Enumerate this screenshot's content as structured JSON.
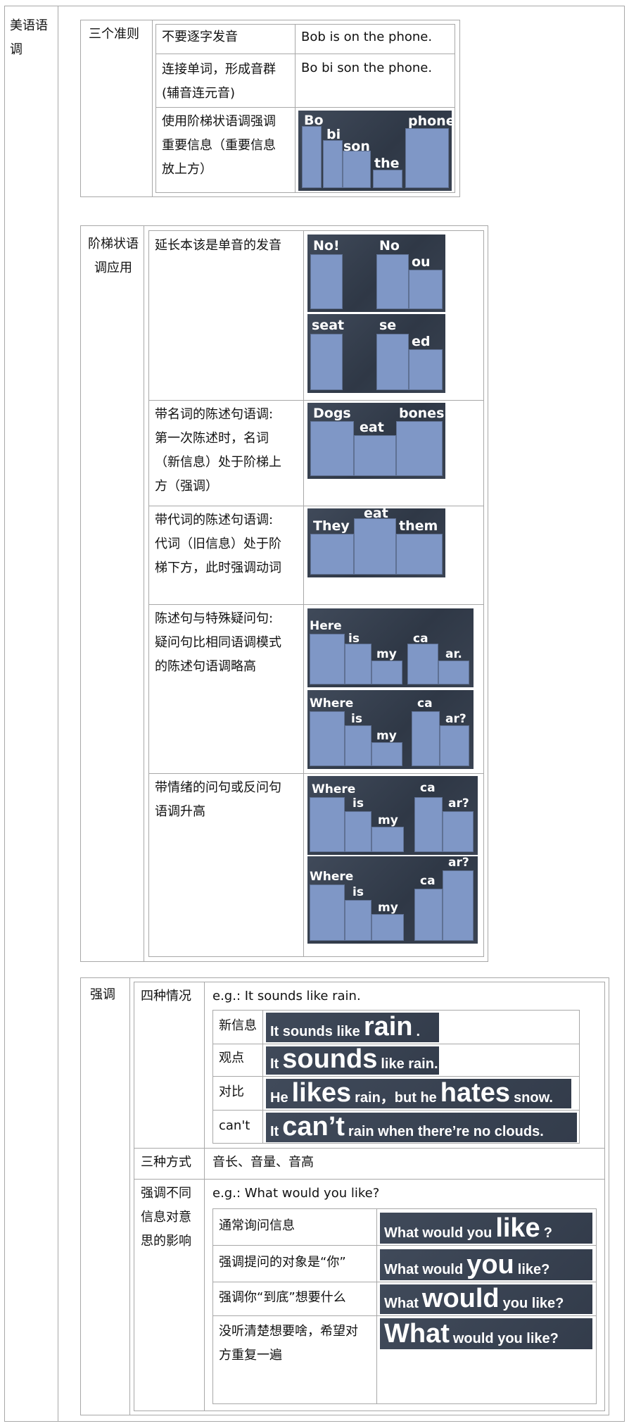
{
  "outer_label": "美语语调",
  "rules": {
    "label": "三个准则",
    "rows": [
      {
        "desc": "不要逐字发音",
        "example": "Bob is on the phone."
      },
      {
        "desc": "连接单词，形成音群\n(辅音连元音)",
        "example": "Bo bi son the phone."
      },
      {
        "desc": "使用阶梯状语调强调\n重要信息（重要信息\n放上方）",
        "words": [
          "Bo",
          "bi",
          "son",
          "the",
          "phone"
        ]
      }
    ]
  },
  "staircase": {
    "label": "阶梯状语\n调应用",
    "rows": [
      {
        "desc": "延长本该是单音的发音",
        "img1": [
          "No!",
          "No",
          "ou"
        ],
        "img2": [
          "seat",
          "se",
          "ed"
        ]
      },
      {
        "desc": "带名词的陈述句语调:\n第一次陈述时，名词\n（新信息）处于阶梯上\n方（强调）",
        "img1": [
          "Dogs",
          "eat",
          "bones"
        ]
      },
      {
        "desc": "带代词的陈述句语调:\n代词（旧信息）处于阶\n梯下方，此时强调动词",
        "img1": [
          "They",
          "eat",
          "them"
        ]
      },
      {
        "desc": "陈述句与特殊疑问句:\n疑问句比相同语调模式\n的陈述句语调略高",
        "img1": [
          "Here",
          "is",
          "my",
          "ca",
          "ar."
        ],
        "img2": [
          "Where",
          "is",
          "my",
          "ca",
          "ar?"
        ]
      },
      {
        "desc": "带情绪的问句或反问句\n语调升高",
        "img1": [
          "Where",
          "is",
          "my",
          "ca",
          "ar?"
        ],
        "img2": [
          "Where",
          "is",
          "my",
          "ca",
          "ar?"
        ]
      }
    ]
  },
  "stress": {
    "label": "强调",
    "four": {
      "label": "四种情况",
      "example": "e.g.: It sounds like rain.",
      "rows": [
        {
          "label": "新信息",
          "parts": [
            [
              "It sounds like",
              "s"
            ],
            [
              "rain",
              "b"
            ],
            [
              ".",
              "s"
            ]
          ]
        },
        {
          "label": "观点",
          "parts": [
            [
              "It",
              "s"
            ],
            [
              "sounds",
              "b"
            ],
            [
              "like rain.",
              "s"
            ]
          ]
        },
        {
          "label": "对比",
          "parts": [
            [
              "He",
              "s"
            ],
            [
              "likes",
              "b"
            ],
            [
              "rain，but he",
              "s"
            ],
            [
              "hates",
              "b"
            ],
            [
              "snow.",
              "s"
            ]
          ]
        },
        {
          "label": "can't",
          "parts": [
            [
              "It",
              "s"
            ],
            [
              "can’t",
              "b"
            ],
            [
              "rain when there’re no clouds.",
              "s"
            ]
          ]
        }
      ]
    },
    "three": {
      "label": "三种方式",
      "value": "音长、音量、音高"
    },
    "meaning": {
      "label": "强调不同\n信息对意\n思的影响",
      "example": "e.g.: What would you like?",
      "rows": [
        {
          "label": "通常询问信息",
          "parts": [
            [
              "What would you",
              "s"
            ],
            [
              "like",
              "b"
            ],
            [
              "?",
              "s"
            ]
          ]
        },
        {
          "label": "强调提问的对象是“你”",
          "parts": [
            [
              "What would",
              "s"
            ],
            [
              "you",
              "b"
            ],
            [
              "like?",
              "s"
            ]
          ]
        },
        {
          "label": "强调你“到底”想要什么",
          "parts": [
            [
              "What",
              "s"
            ],
            [
              "would",
              "b"
            ],
            [
              "you like?",
              "s"
            ]
          ]
        },
        {
          "label": "没听清楚想要啥，希望对\n方重复一遍",
          "parts": [
            [
              "What",
              "b"
            ],
            [
              "would you like?",
              "s"
            ]
          ]
        }
      ]
    }
  }
}
